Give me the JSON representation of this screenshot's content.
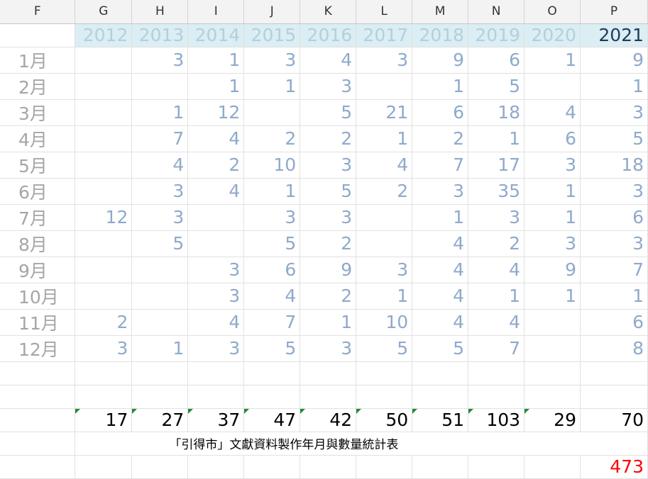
{
  "columns": [
    "F",
    "G",
    "H",
    "I",
    "J",
    "K",
    "L",
    "M",
    "N",
    "O",
    "P"
  ],
  "years": [
    "2012",
    "2013",
    "2014",
    "2015",
    "2016",
    "2017",
    "2018",
    "2019",
    "2020",
    "2021"
  ],
  "months": [
    {
      "label": "1月",
      "values": [
        "",
        "3",
        "1",
        "3",
        "4",
        "3",
        "9",
        "6",
        "1",
        "9"
      ]
    },
    {
      "label": "2月",
      "values": [
        "",
        "",
        "1",
        "1",
        "3",
        "",
        "1",
        "5",
        "",
        "1"
      ]
    },
    {
      "label": "3月",
      "values": [
        "",
        "1",
        "12",
        "",
        "5",
        "21",
        "6",
        "18",
        "4",
        "3"
      ]
    },
    {
      "label": "4月",
      "values": [
        "",
        "7",
        "4",
        "2",
        "2",
        "1",
        "2",
        "1",
        "6",
        "5"
      ]
    },
    {
      "label": "5月",
      "values": [
        "",
        "4",
        "2",
        "10",
        "3",
        "4",
        "7",
        "17",
        "3",
        "18"
      ]
    },
    {
      "label": "6月",
      "values": [
        "",
        "3",
        "4",
        "1",
        "5",
        "2",
        "3",
        "35",
        "1",
        "3"
      ]
    },
    {
      "label": "7月",
      "values": [
        "12",
        "3",
        "",
        "3",
        "3",
        "",
        "1",
        "3",
        "1",
        "6"
      ]
    },
    {
      "label": "8月",
      "values": [
        "",
        "5",
        "",
        "5",
        "2",
        "",
        "4",
        "2",
        "3",
        "3"
      ]
    },
    {
      "label": "9月",
      "values": [
        "",
        "",
        "3",
        "6",
        "9",
        "3",
        "4",
        "4",
        "9",
        "7"
      ]
    },
    {
      "label": "10月",
      "values": [
        "",
        "",
        "3",
        "4",
        "2",
        "1",
        "4",
        "1",
        "1",
        "1"
      ]
    },
    {
      "label": "11月",
      "values": [
        "2",
        "",
        "4",
        "7",
        "1",
        "10",
        "4",
        "4",
        "",
        "6"
      ]
    },
    {
      "label": "12月",
      "values": [
        "3",
        "1",
        "3",
        "5",
        "3",
        "5",
        "5",
        "7",
        "",
        "8"
      ]
    }
  ],
  "totals": [
    "17",
    "27",
    "37",
    "47",
    "42",
    "50",
    "51",
    "103",
    "29",
    "70"
  ],
  "caption": "「引得市」文獻資料製作年月與數量統計表",
  "grand_total": "473"
}
